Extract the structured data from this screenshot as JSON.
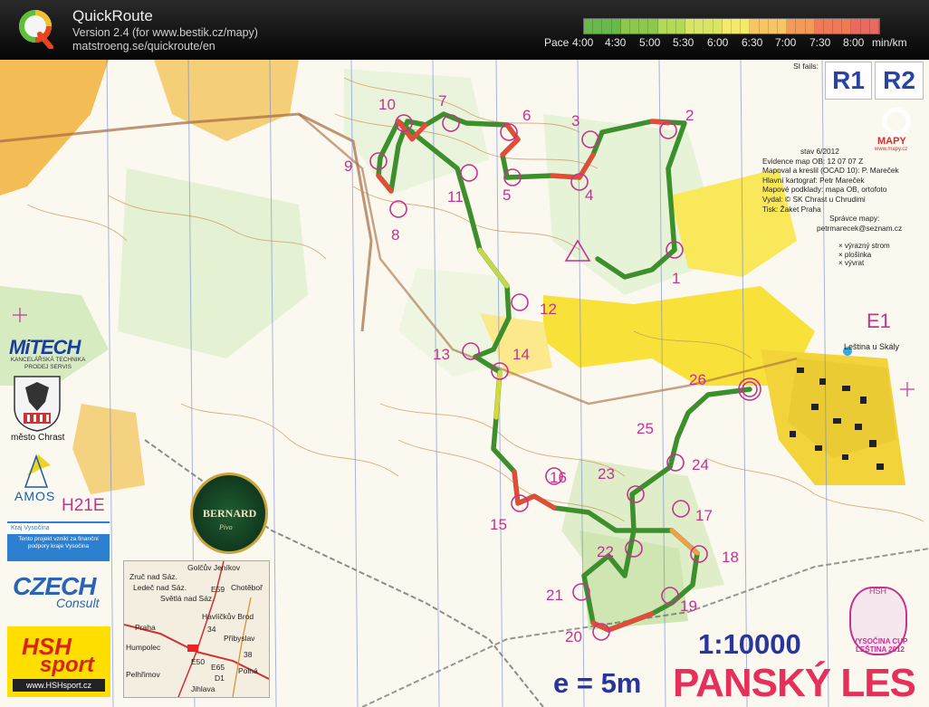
{
  "app": {
    "title": "QuickRoute",
    "version": "Version 2.4  (for www.bestik.cz/mapy)",
    "url": "matstroeng.se/quickroute/en",
    "logo_letter": "Q"
  },
  "pace": {
    "prefix": "Pace",
    "labels": [
      "4:00",
      "4:30",
      "5:00",
      "5:30",
      "6:00",
      "6:30",
      "7:00",
      "7:30",
      "8:00"
    ],
    "unit": "min/km",
    "gradient_colors": [
      "#69b94a",
      "#8cc84e",
      "#b4d957",
      "#dbe565",
      "#f4e96b",
      "#f7c663",
      "#f39a5a",
      "#ef7a58",
      "#ea6a5e"
    ]
  },
  "map": {
    "si_fails_label": "SI fails:",
    "course_codes": [
      "R1",
      "R2"
    ],
    "publisher_logo": "MAPY",
    "publisher_url": "www.mapy.cz",
    "info": [
      "stav 6/2012",
      "Evidence map OB:    12 07 07 Z",
      "Mapoval a kreslil (OCAD 10):  P. Mareček",
      "Hlavní kartograf:    Petr Mareček",
      "Mapové podklady:     mapa OB, ortofoto",
      "Vydal:    © SK Chrast u Chrudimi",
      "Tisk:   Žaket Praha",
      "Správce mapy:",
      "petrmarecek@seznam.cz"
    ],
    "legend": [
      "× výrazný strom",
      "× plošinka",
      "× vývrat"
    ],
    "event_label": "E1",
    "village_label": "Leština u Skály",
    "category": "H21E",
    "scale": "1:10000",
    "contour_interval": "e = 5m",
    "map_name": "PANSKÝ LES",
    "controls": [
      "1",
      "2",
      "3",
      "4",
      "5",
      "6",
      "7",
      "8",
      "9",
      "10",
      "11",
      "12",
      "13",
      "14",
      "15",
      "16",
      "17",
      "18",
      "19",
      "20",
      "21",
      "22",
      "23",
      "24",
      "25",
      "26"
    ],
    "sponsors": {
      "mitech": "MiTECH",
      "mitech_sub": "KANCELÁŘSKÁ TECHNIKA PRODEJ SERVIS",
      "chrast": "město Chrast",
      "amos": "AMOS",
      "vysocina_top": "Kraj Vysočina",
      "vysocina_text": "Tento projekt vznikl za finanční podpory kraje Vysočina",
      "czech": "CZECH",
      "consult": "Consult",
      "hsh": "HSH",
      "sport": "sport",
      "hsh_url": "www.HSHsport.cz",
      "bernard": "BERNARD",
      "bernard_sub": "Pivo",
      "cup_top": "HSH",
      "cup_text": "VYSOČINA CUP LEŠTINA 2012"
    },
    "inset_places": [
      "Golčův Jeníkov",
      "Zruč nad Sáz.",
      "Ledeč nad Sáz.",
      "Světlá nad Sáz.",
      "Chotěboř",
      "Havlíčkův Brod",
      "Praha",
      "Humpolec",
      "Přibyslav",
      "Pelhřimov",
      "Polná",
      "Jihlava"
    ],
    "inset_roads": [
      "E59",
      "34",
      "E50",
      "E65",
      "D1",
      "38"
    ]
  }
}
